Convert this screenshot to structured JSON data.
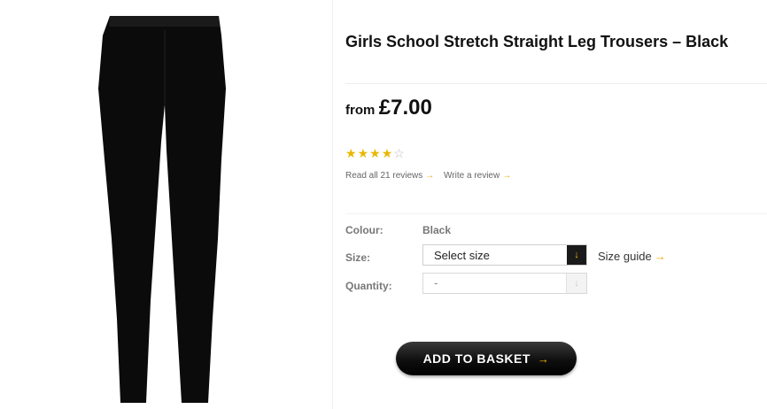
{
  "product": {
    "title": "Girls School Stretch Straight Leg Trousers – Black",
    "price_prefix": "from",
    "price": "£7.00",
    "rating": {
      "stars_filled": 4,
      "stars_total": 5
    },
    "read_reviews": "Read all 21 reviews",
    "write_review": "Write a review",
    "image_icon": "trousers-image",
    "colors": {
      "star": "#e9b700",
      "arrow": "#f0a800",
      "button": "#111111"
    }
  },
  "options": {
    "colour_label": "Colour:",
    "colour_value": "Black",
    "size_label": "Size:",
    "size_value": "Select size",
    "size_guide": "Size guide",
    "quantity_label": "Quantity:",
    "quantity_value": "-"
  },
  "actions": {
    "add_to_basket": "ADD TO BASKET"
  }
}
